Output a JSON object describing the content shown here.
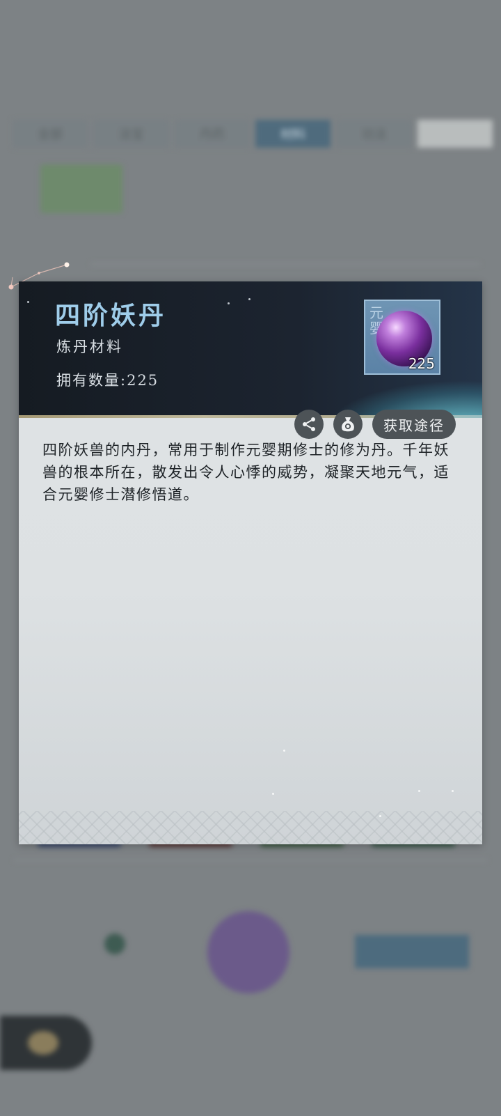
{
  "background": {
    "tabs": [
      "全部",
      "法宝",
      "丹药",
      "材料",
      "功法"
    ],
    "active_tab_index": 3,
    "search_label": "",
    "thumb_label": "",
    "section_label": "",
    "bottom_title": "",
    "bottom_count": "",
    "bottom_button": ""
  },
  "item": {
    "name": "四阶妖丹",
    "type": "炼丹材料",
    "owned_label": "拥有数量:",
    "owned_count": "225",
    "icon_tag": "元婴",
    "icon_count": "225",
    "description": "四阶妖兽的内丹，常用于制作元婴期修士的修为丹。千年妖兽的根本所在，散发出令人心悸的威势，凝聚天地元气，适合元婴修士潜修悟道。"
  },
  "actions": {
    "share_icon": "share-icon",
    "bag_icon": "money-bag-icon",
    "acquire_label": "获取途径"
  },
  "colors": {
    "title": "#9fcdea",
    "header_bg": "#151b22",
    "button_bg": "#4d5357"
  }
}
